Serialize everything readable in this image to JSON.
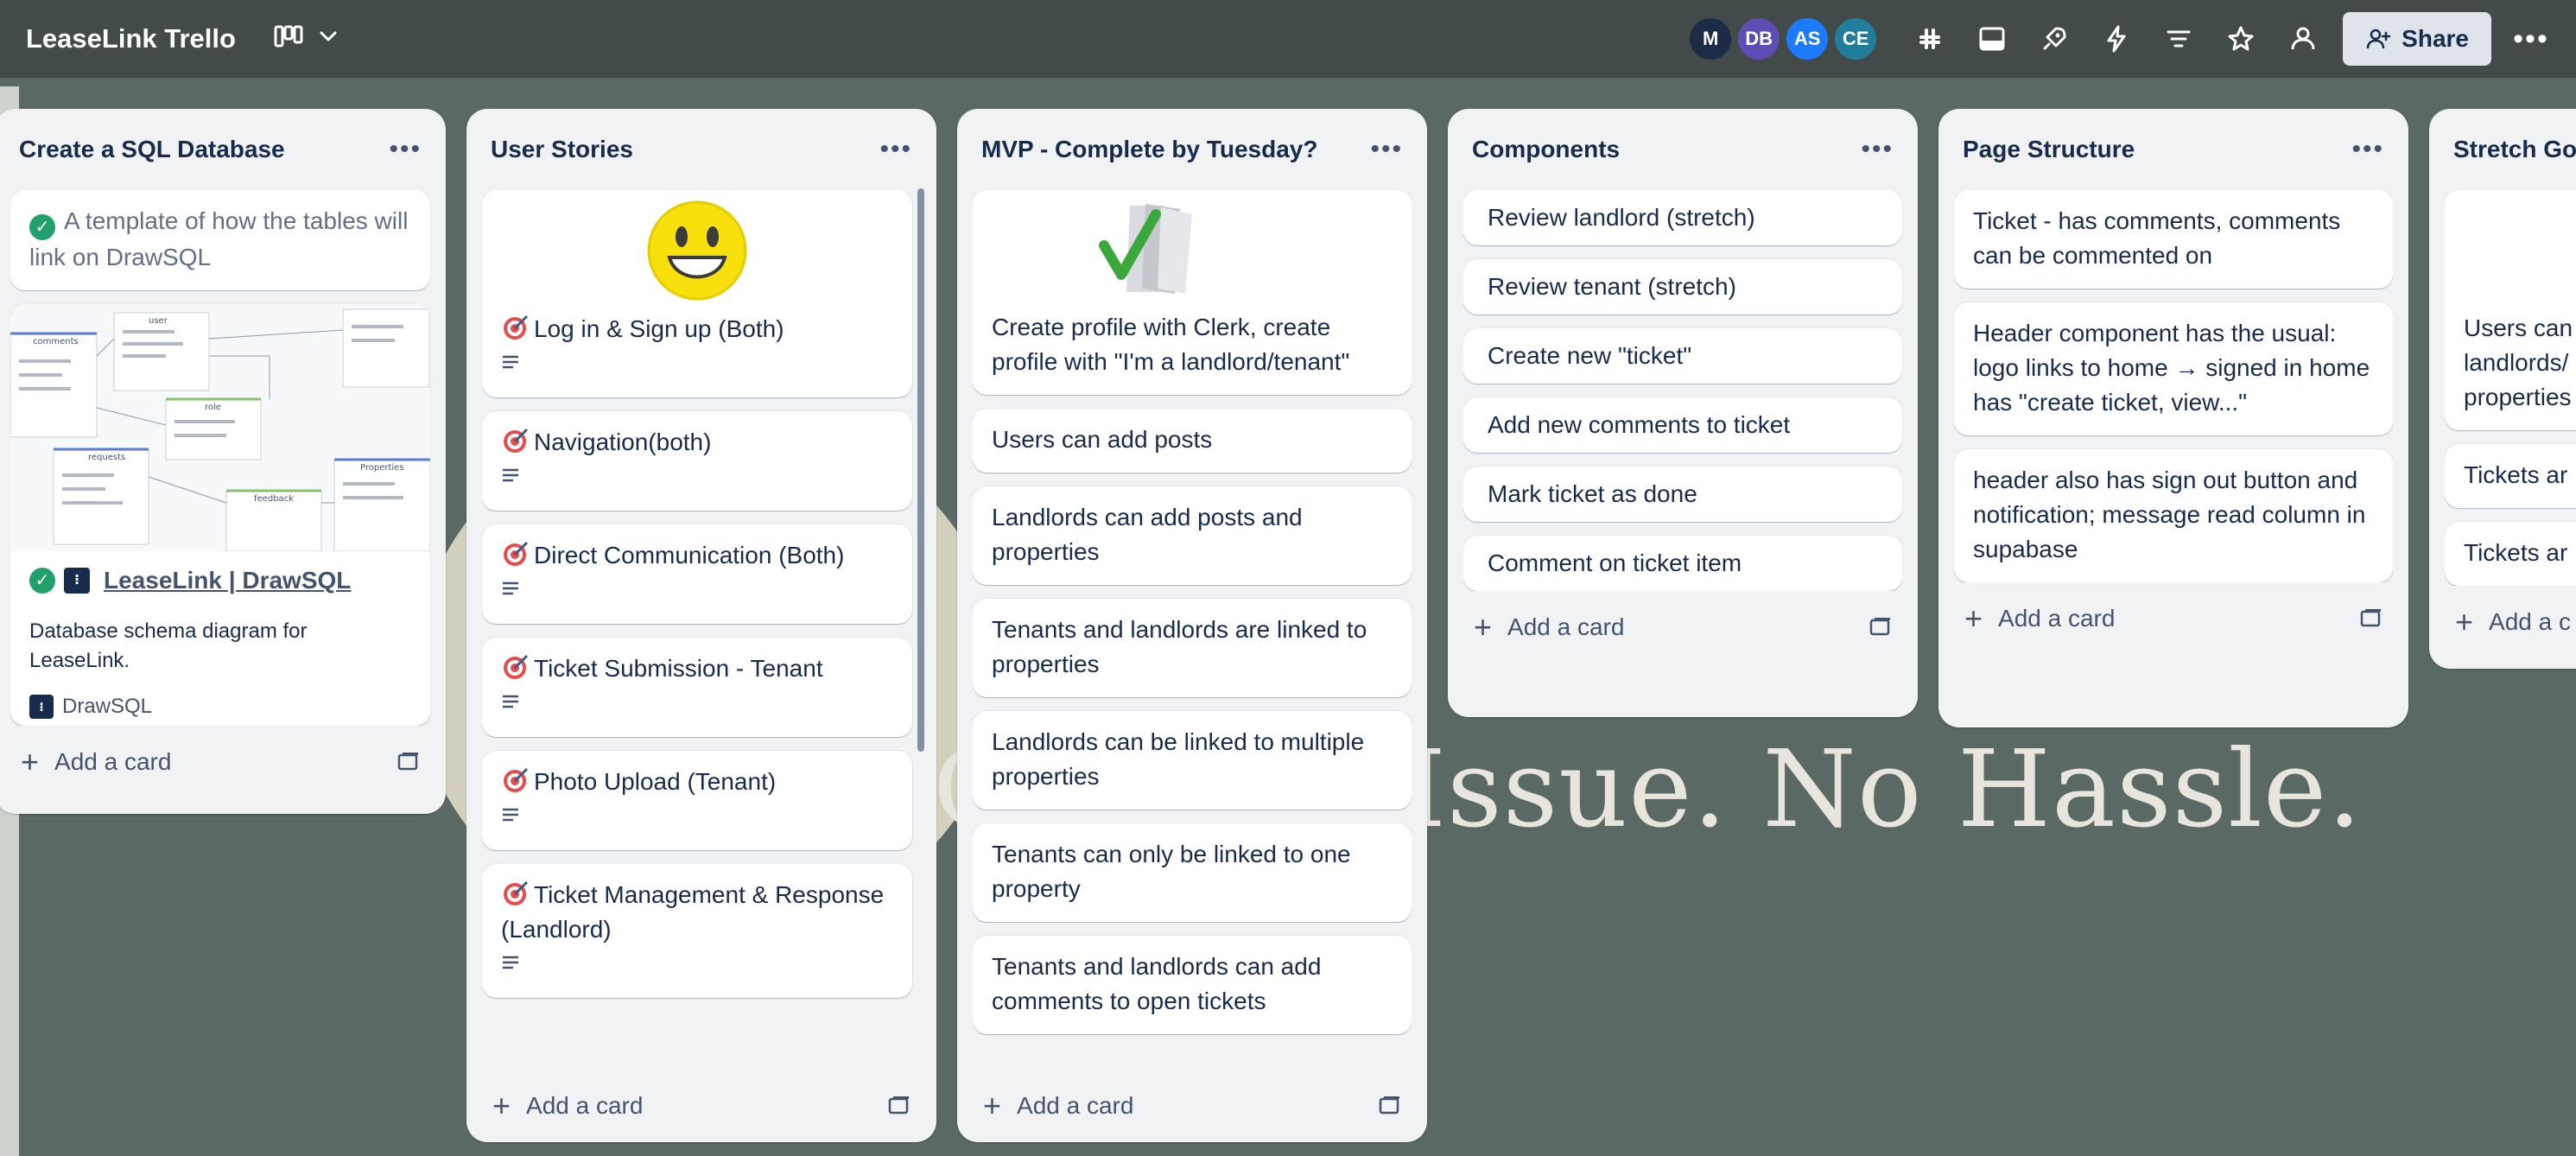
{
  "app": {
    "board_title": "LeaseLink Trello"
  },
  "background": {
    "tagline": "Every Issue. No Hassle.",
    "tagline_prefix": "C"
  },
  "header": {
    "view_icon": "board-icon",
    "avatars": [
      {
        "initials": "M",
        "color": "#1d2b47"
      },
      {
        "initials": "DB",
        "color": "#5e4db2"
      },
      {
        "initials": "AS",
        "color": "#1d7afc"
      },
      {
        "initials": "CE",
        "color": "#227d9b"
      }
    ],
    "share_label": "Share"
  },
  "lists": {
    "sql": {
      "title": "Create a SQL Database",
      "cards": [
        {
          "text": "A template of how the tables will link on DrawSQL"
        }
      ],
      "link_card": {
        "link_title": "LeaseLink | DrawSQL",
        "description": "Database schema diagram for LeaseLink.",
        "source": "DrawSQL",
        "diagram_tables": [
          "user",
          "comments",
          "role",
          "requests",
          "feedback",
          "Properties"
        ]
      },
      "add_label": "Add a card"
    },
    "stories": {
      "title": "User Stories",
      "cards": [
        {
          "text": "Log in & Sign up (Both)"
        },
        {
          "text": "Navigation(both)"
        },
        {
          "text": "Direct Communication (Both)"
        },
        {
          "text": "Ticket Submission - Tenant"
        },
        {
          "text": "Photo Upload (Tenant)"
        },
        {
          "text": "Ticket Management & Response (Landlord)"
        }
      ],
      "add_label": "Add a card"
    },
    "mvp": {
      "title": "MVP - Complete by Tuesday?",
      "cards": [
        {
          "text": "Create profile with Clerk, create profile with \"I'm a landlord/tenant\""
        },
        {
          "text": "Users can add posts"
        },
        {
          "text": "Landlords can add posts and properties"
        },
        {
          "text": "Tenants and landlords are linked to properties"
        },
        {
          "text": "Landlords can be linked to multiple properties"
        },
        {
          "text": "Tenants can only be linked to one property"
        },
        {
          "text": "Tenants and landlords can add comments to open tickets"
        }
      ],
      "add_label": "Add a card"
    },
    "components": {
      "title": "Components",
      "cards": [
        {
          "text": "Review landlord (stretch)"
        },
        {
          "text": "Review tenant (stretch)"
        },
        {
          "text": "Create new \"ticket\""
        },
        {
          "text": "Add new comments to ticket"
        },
        {
          "text": "Mark ticket as done"
        },
        {
          "text": "Comment on ticket item"
        }
      ],
      "add_label": "Add a card"
    },
    "page_structure": {
      "title": "Page Structure",
      "cards": [
        {
          "text": "Ticket - has comments, comments can be commented on"
        },
        {
          "text": "Header component has the usual: logo links to home → signed in home has \"create ticket, view...\""
        },
        {
          "text": "header also has sign out button and notification; message read column in supabase"
        }
      ],
      "add_label": "Add a card"
    },
    "stretch": {
      "title": "Stretch Go",
      "cards": [
        {
          "text": "Users can landlords/ properties"
        },
        {
          "text": "Tickets ar"
        },
        {
          "text": "Tickets ar"
        }
      ],
      "add_label": "Add a c"
    }
  }
}
